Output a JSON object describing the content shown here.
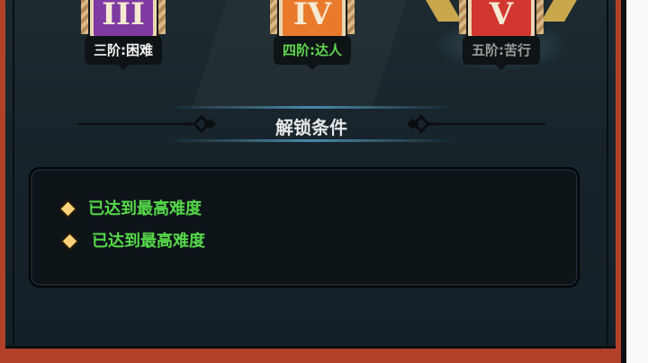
{
  "tiers": [
    {
      "numeral": "III",
      "label": "三阶:困难",
      "label_color": "#f2f2f2",
      "banner_color": "#7f3aa2"
    },
    {
      "numeral": "IV",
      "label": "四阶:达人",
      "label_color": "#5fd84e",
      "banner_color": "#e97a2c"
    },
    {
      "numeral": "V",
      "label": "五阶:苦行",
      "label_color": "#9a9a9a",
      "banner_color": "#d2372f",
      "state": "selected"
    }
  ],
  "unlock": {
    "title": "解锁条件",
    "conditions": [
      {
        "text": "已达到最高难度",
        "bullet": "diamond-icon",
        "color": "#56d84a"
      },
      {
        "text": "已达到最高难度",
        "bullet": "diamond-icon",
        "color": "#56d84a"
      }
    ]
  },
  "colors": {
    "frame": "#b2412a",
    "panel": "#1b272d",
    "accent_gold": "#ffd27a"
  }
}
